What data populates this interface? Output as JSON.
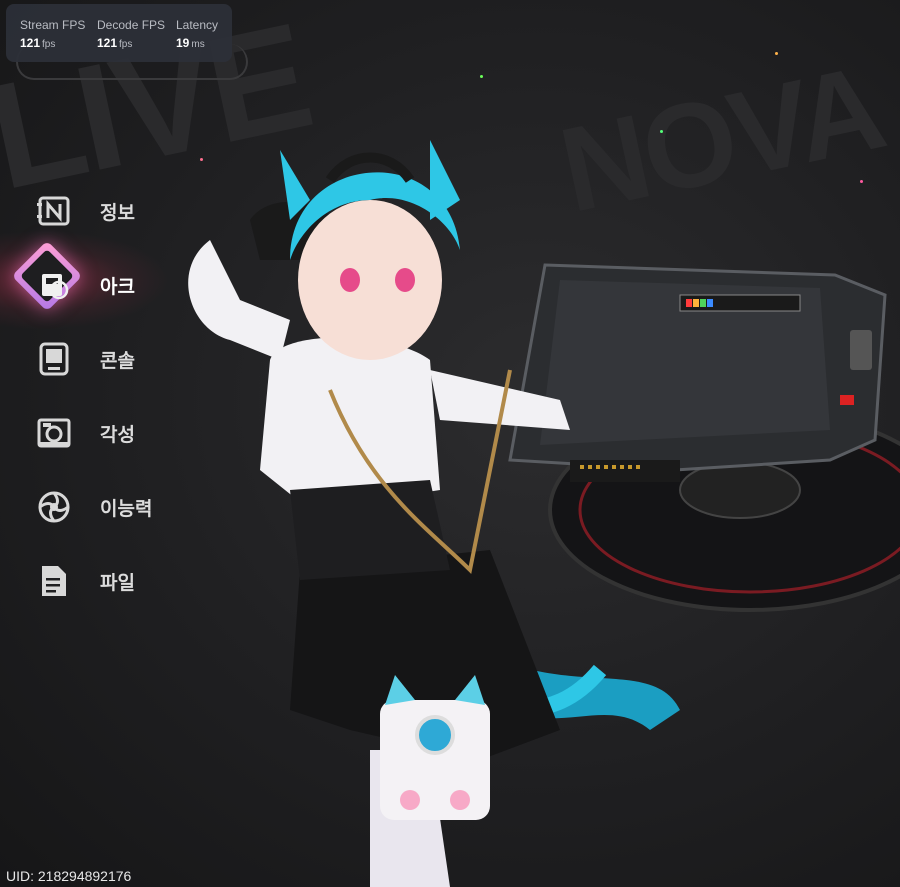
{
  "stats": [
    {
      "label": "Stream FPS",
      "value": "121",
      "unit": "fps"
    },
    {
      "label": "Decode FPS",
      "value": "121",
      "unit": "fps"
    },
    {
      "label": "Latency",
      "value": "19",
      "unit": "ms"
    }
  ],
  "menu": {
    "items": [
      {
        "label": "정보",
        "icon": "info-n-icon",
        "active": false
      },
      {
        "label": "아크",
        "icon": "arc-icon",
        "active": true
      },
      {
        "label": "콘솔",
        "icon": "console-icon",
        "active": false
      },
      {
        "label": "각성",
        "icon": "awakening-icon",
        "active": false
      },
      {
        "label": "이능력",
        "icon": "ability-icon",
        "active": false
      },
      {
        "label": "파일",
        "icon": "file-icon",
        "active": false
      }
    ]
  },
  "footer": {
    "uid": "UID: 218294892176"
  },
  "colors": {
    "accent_pink": "#ff6fb0",
    "hair_cyan": "#2ec7e6",
    "background": "#1f1f21"
  }
}
